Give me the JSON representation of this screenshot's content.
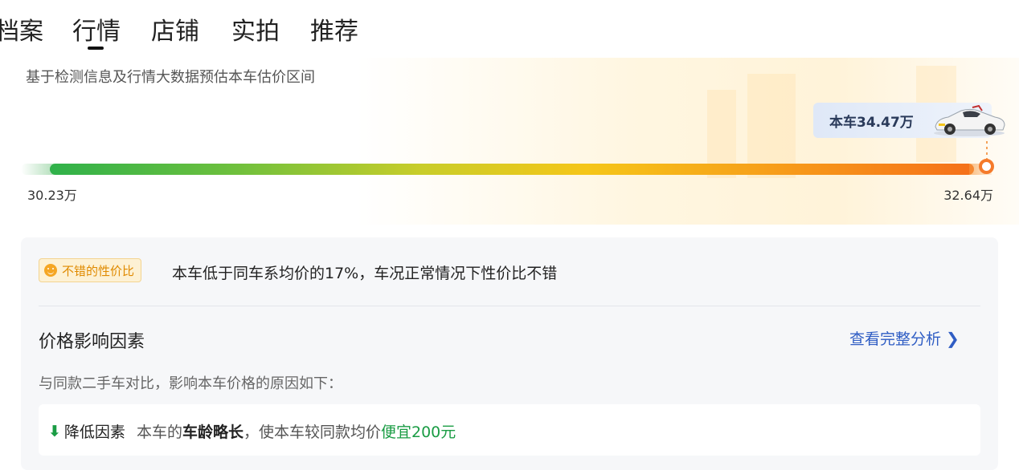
{
  "tabs": [
    {
      "label": "档案",
      "active": false
    },
    {
      "label": "行情",
      "active": true
    },
    {
      "label": "店铺",
      "active": false
    },
    {
      "label": "实拍",
      "active": false
    },
    {
      "label": "推荐",
      "active": false
    }
  ],
  "estimate": {
    "subtitle": "基于检测信息及行情大数据预估本车估价区间",
    "car_price_label": "本车34.47万",
    "range_min": "30.23万",
    "range_max": "32.64万",
    "bar_colors": [
      "#2fb14a",
      "#f5c619",
      "#f5701a"
    ]
  },
  "analysis": {
    "tag_icon": "smile-icon",
    "tag_label": "不错的性价比",
    "summary": "本车低于同车系均价的17%，车况正常情况下性价比不错",
    "factors_title": "价格影响因素",
    "full_analysis_link": "查看完整分析",
    "factors_subtitle": "与同款二手车对比，影响本车价格的原因如下：",
    "factor": {
      "icon": "arrow-down-icon",
      "label": "降低因素",
      "prefix": "本车的",
      "highlight": "车龄略长",
      "middle": "，使本车较同款均价",
      "savings": "便宜200元"
    }
  },
  "colors": {
    "accent_link": "#2f5dc4",
    "positive_green": "#1a9c44",
    "tag_orange": "#e08a00"
  }
}
